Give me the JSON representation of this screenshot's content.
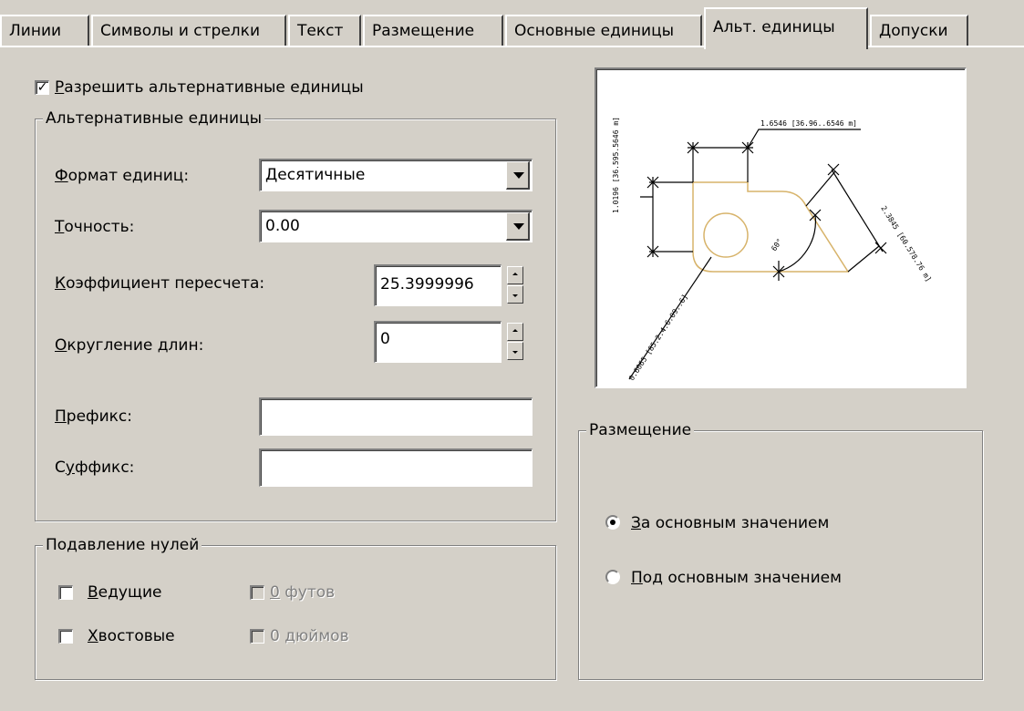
{
  "tabs": [
    {
      "label": "Линии"
    },
    {
      "label": "Символы и стрелки"
    },
    {
      "label": "Текст"
    },
    {
      "label": "Размещение"
    },
    {
      "label": "Основные единицы"
    },
    {
      "label": "Альт. единицы"
    },
    {
      "label": "Допуски"
    }
  ],
  "enable_alt": {
    "checked": true,
    "prefix": "",
    "hotkey": "Р",
    "rest": "азрешить альтернативные единицы"
  },
  "alt_units": {
    "title": "Альтернативные единицы",
    "unit_format": {
      "hotkey": "Ф",
      "rest": "ормат единиц:",
      "value": "Десятичные"
    },
    "precision": {
      "hotkey": "Т",
      "rest": "очность:",
      "value": "0.00"
    },
    "multiplier": {
      "hotkey": "К",
      "rest": "оэффициент пересчета:",
      "value": "25.3999996"
    },
    "round": {
      "hotkey": "О",
      "rest": "кругление длин:",
      "value": "0"
    },
    "prefix": {
      "hotkey": "П",
      "rest": "рефикс:",
      "value": ""
    },
    "suffix": {
      "pre": "С",
      "hotkey": "у",
      "rest": "ффикс:",
      "value": ""
    }
  },
  "zero_suppression": {
    "title": "Подавление нулей",
    "leading": {
      "hotkey": "В",
      "rest": "едущие",
      "checked": false
    },
    "trailing": {
      "hotkey": "Х",
      "rest": "востовые",
      "checked": false
    },
    "feet": {
      "hotkey": "0",
      "rest": " футов",
      "checked": false
    },
    "inches": {
      "pre": "0 ",
      "hotkey": "д",
      "rest": "юймов",
      "checked": false
    }
  },
  "placement": {
    "title": "Размещение",
    "after": {
      "hotkey": "З",
      "rest": "а основным значением",
      "selected": true
    },
    "below": {
      "hotkey": "П",
      "rest": "од основным значением",
      "selected": false
    }
  },
  "preview": {
    "top_dim": "1.6546 [36.96..6546 m]",
    "left_dim": "1.0196 [36.595.5646 m]",
    "right_dim": "2.3845 [60.578.76 m]",
    "diag_dim": "0.6065 [85.2.4.6.09..6]",
    "angle_dim": "60°",
    "part_color": "#d7b36a"
  }
}
